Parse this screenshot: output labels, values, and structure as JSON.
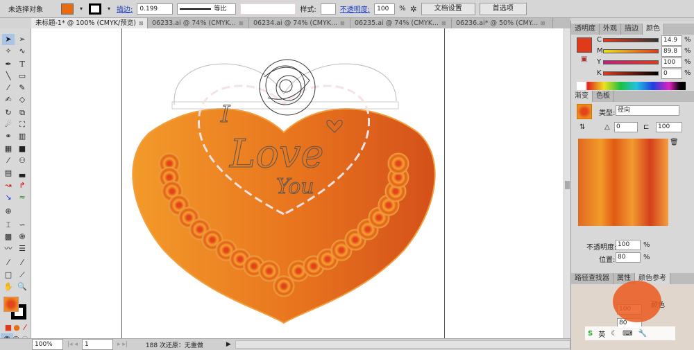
{
  "control_bar": {
    "selection": "未选择对象",
    "stroke_label": "描边:",
    "stroke_weight": "0.199",
    "profile": "等比",
    "style_label": "样式:",
    "opacity_label": "不透明度:",
    "opacity": "100",
    "percent": "%",
    "doc_setup": "文档设置",
    "preferences": "首选项",
    "fill_color": "#ea6a10",
    "stroke_color": "#000000"
  },
  "tabs": [
    {
      "label": "未标题-1* @ 100% (CMYK/预览)",
      "active": true
    },
    {
      "label": "06233.ai @ 74% (CMYK..."
    },
    {
      "label": "06234.ai @ 74% (CMYK..."
    },
    {
      "label": "06235.ai @ 74% (CMYK..."
    },
    {
      "label": "06236.ai* @ 50% (CMY..."
    }
  ],
  "artwork": {
    "text_i": "I",
    "text_love": "Love",
    "text_you": "You",
    "heart_colors": [
      "#f39a2a",
      "#e05a14",
      "#c9420f"
    ]
  },
  "status": {
    "zoom": "100%",
    "page": "1",
    "history": "188 次还原：无重做"
  },
  "color_panel": {
    "tabs": [
      "透明度",
      "外观",
      "描边",
      "颜色"
    ],
    "swatch": "#e03a1a",
    "channels": [
      {
        "name": "C",
        "value": "14.9"
      },
      {
        "name": "M",
        "value": "89.8"
      },
      {
        "name": "Y",
        "value": "100"
      },
      {
        "name": "K",
        "value": "0"
      }
    ],
    "percent": "%"
  },
  "gradient_panel": {
    "tabs": [
      "渐变",
      "色板"
    ],
    "type_label": "类型:",
    "type": "径向",
    "angle": "0",
    "aspect": "100",
    "opacity_label": "不透明度:",
    "opacity": "100",
    "location_label": "位置:",
    "location": "80",
    "percent": "%"
  },
  "bottom_panel": {
    "tabs": [
      "路径查找器",
      "属性",
      "颜色参考"
    ],
    "label_color": "颜色",
    "opacity": "100",
    "location": "80"
  },
  "ime": {
    "label": "英"
  }
}
